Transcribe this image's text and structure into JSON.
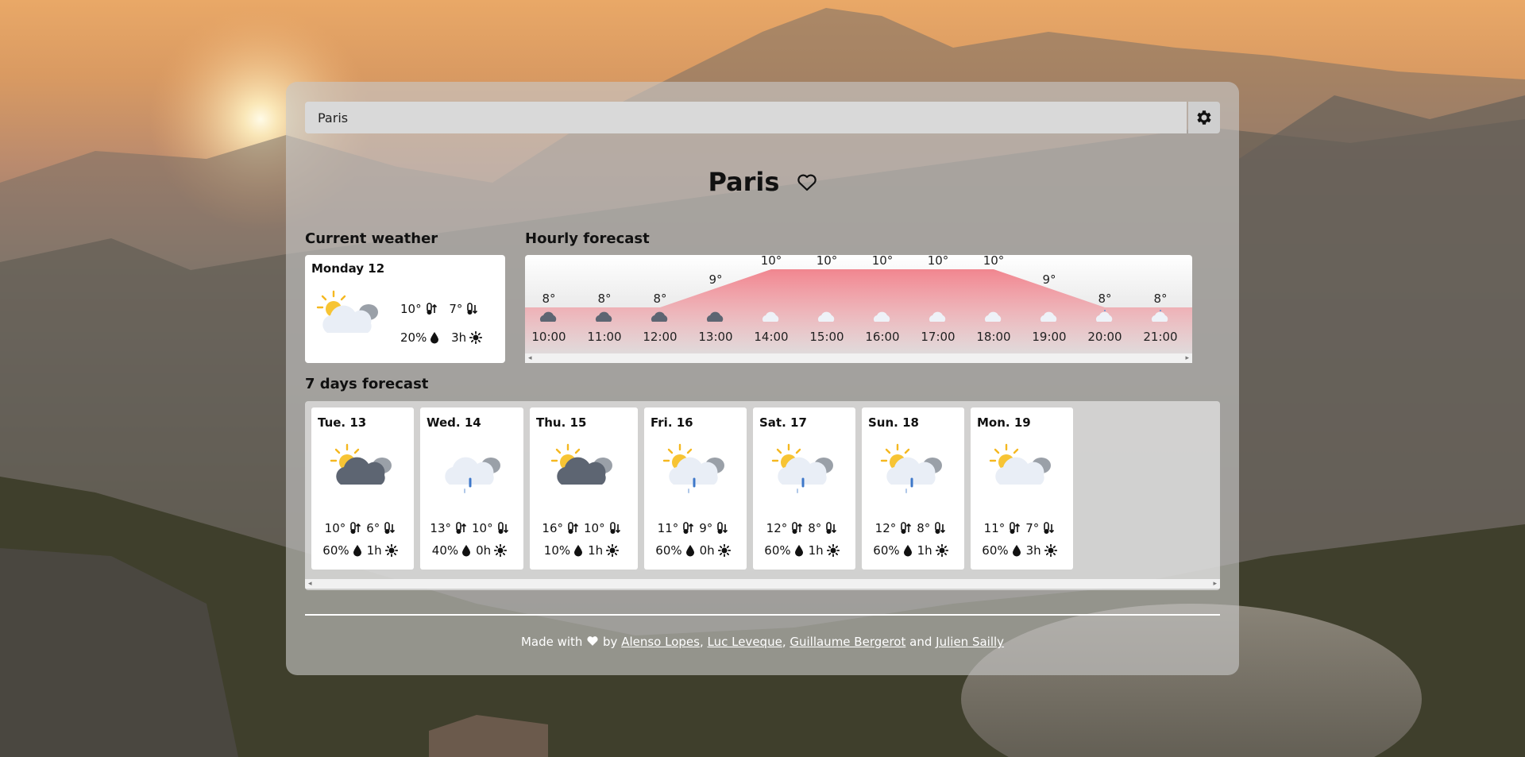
{
  "search": {
    "value": "Paris"
  },
  "city": {
    "name": "Paris"
  },
  "current": {
    "title": "Current weather",
    "day": "Monday 12",
    "icon": "sun-behind-cloud-icon",
    "max_temp": "10°",
    "min_temp": "7°",
    "rain": "20%",
    "sun": "3h"
  },
  "hourly": {
    "title": "Hourly forecast",
    "hours": [
      {
        "time": "10:00",
        "temp": "8°",
        "t": 8,
        "icon": "cloud-dark-icon"
      },
      {
        "time": "11:00",
        "temp": "8°",
        "t": 8,
        "icon": "cloud-dark-icon"
      },
      {
        "time": "12:00",
        "temp": "8°",
        "t": 8,
        "icon": "cloud-dark-icon"
      },
      {
        "time": "13:00",
        "temp": "9°",
        "t": 9,
        "icon": "cloud-dark-icon"
      },
      {
        "time": "14:00",
        "temp": "10°",
        "t": 10,
        "icon": "cloud-light-icon"
      },
      {
        "time": "15:00",
        "temp": "10°",
        "t": 10,
        "icon": "cloud-light-icon"
      },
      {
        "time": "16:00",
        "temp": "10°",
        "t": 10,
        "icon": "cloud-light-icon"
      },
      {
        "time": "17:00",
        "temp": "10°",
        "t": 10,
        "icon": "cloud-light-icon"
      },
      {
        "time": "18:00",
        "temp": "10°",
        "t": 10,
        "icon": "cloud-light-icon"
      },
      {
        "time": "19:00",
        "temp": "9°",
        "t": 9,
        "icon": "cloud-light-icon"
      },
      {
        "time": "20:00",
        "temp": "8°",
        "t": 8,
        "icon": "cloud-rain-icon"
      },
      {
        "time": "21:00",
        "temp": "8°",
        "t": 8,
        "icon": "cloud-rain-icon"
      }
    ]
  },
  "forecast": {
    "title": "7 days forecast",
    "days": [
      {
        "name": "Tue. 13",
        "icon": "sun-behind-dark-cloud-icon",
        "max": "10°",
        "min": "6°",
        "rain": "60%",
        "sun": "1h"
      },
      {
        "name": "Wed. 14",
        "icon": "cloud-rain-icon",
        "max": "13°",
        "min": "10°",
        "rain": "40%",
        "sun": "0h"
      },
      {
        "name": "Thu. 15",
        "icon": "sun-behind-dark-cloud-icon",
        "max": "16°",
        "min": "10°",
        "rain": "10%",
        "sun": "1h"
      },
      {
        "name": "Fri. 16",
        "icon": "sun-behind-rain-cloud-icon",
        "max": "11°",
        "min": "9°",
        "rain": "60%",
        "sun": "0h"
      },
      {
        "name": "Sat. 17",
        "icon": "sun-behind-rain-cloud-icon",
        "max": "12°",
        "min": "8°",
        "rain": "60%",
        "sun": "1h"
      },
      {
        "name": "Sun. 18",
        "icon": "sun-behind-rain-cloud-icon",
        "max": "12°",
        "min": "8°",
        "rain": "60%",
        "sun": "1h"
      },
      {
        "name": "Mon. 19",
        "icon": "sun-behind-cloud-icon",
        "max": "11°",
        "min": "7°",
        "rain": "60%",
        "sun": "3h"
      }
    ]
  },
  "footer": {
    "made_with": "Made with",
    "by": "by",
    "and": "and",
    "authors": [
      "Alenso Lopes",
      "Luc Leveque",
      "Guillaume Bergerot",
      "Julien Sailly"
    ]
  },
  "colors": {
    "temp_curve": "#f07f89",
    "panel": "#c8c8c8"
  }
}
